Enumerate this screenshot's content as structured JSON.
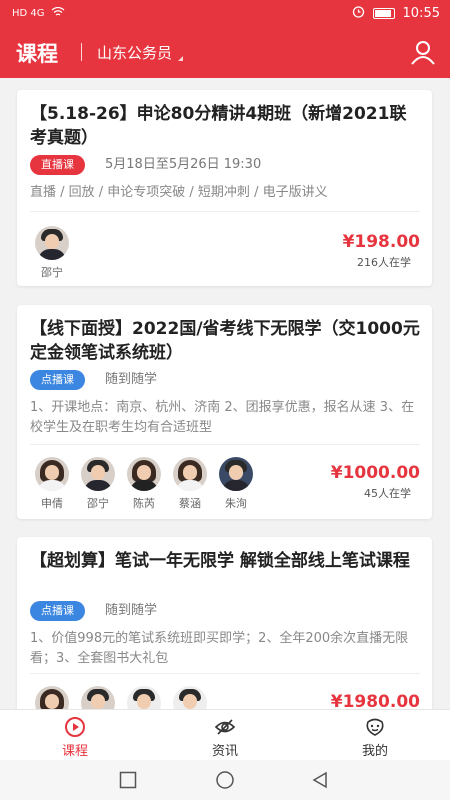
{
  "status_bar": {
    "signal": "HD 4G",
    "time": "10:55"
  },
  "header": {
    "title": "课程",
    "region": "山东公务员"
  },
  "courses": [
    {
      "title": "【5.18-26】申论80分精讲4期班（新增2021联考真题）",
      "tag": "直播课",
      "schedule": "5月18日至5月26日  19:30",
      "desc": "直播 / 回放 / 申论专项突破 / 短期冲刺 / 电子版讲义",
      "teachers": [
        "邵宁"
      ],
      "price": "¥198.00",
      "learners": "216人在学"
    },
    {
      "title": "【线下面授】2022国/省考线下无限学（交1000元定金领笔试系统班）",
      "tag": "点播课",
      "schedule": "随到随学",
      "desc": "1、开课地点：南京、杭州、济南 2、团报享优惠，报名从速 3、在校学生及在职考生均有合适班型",
      "teachers": [
        "申倩",
        "邵宁",
        "陈芮",
        "蔡涵",
        "朱洵"
      ],
      "price": "¥1000.00",
      "learners": "45人在学"
    },
    {
      "title": "【超划算】笔试一年无限学 解锁全部线上笔试课程",
      "tag": "点播课",
      "schedule": "随到随学",
      "desc": "1、价值998元的笔试系统班即买即学；2、全年200余次直播无限看；3、全套图书大礼包",
      "price": "¥1980.00"
    }
  ],
  "bottom_nav": {
    "courses": "课程",
    "news": "资讯",
    "mine": "我的"
  },
  "colors": {
    "brand": "#e7353f",
    "vod_tag": "#3b86e0"
  }
}
